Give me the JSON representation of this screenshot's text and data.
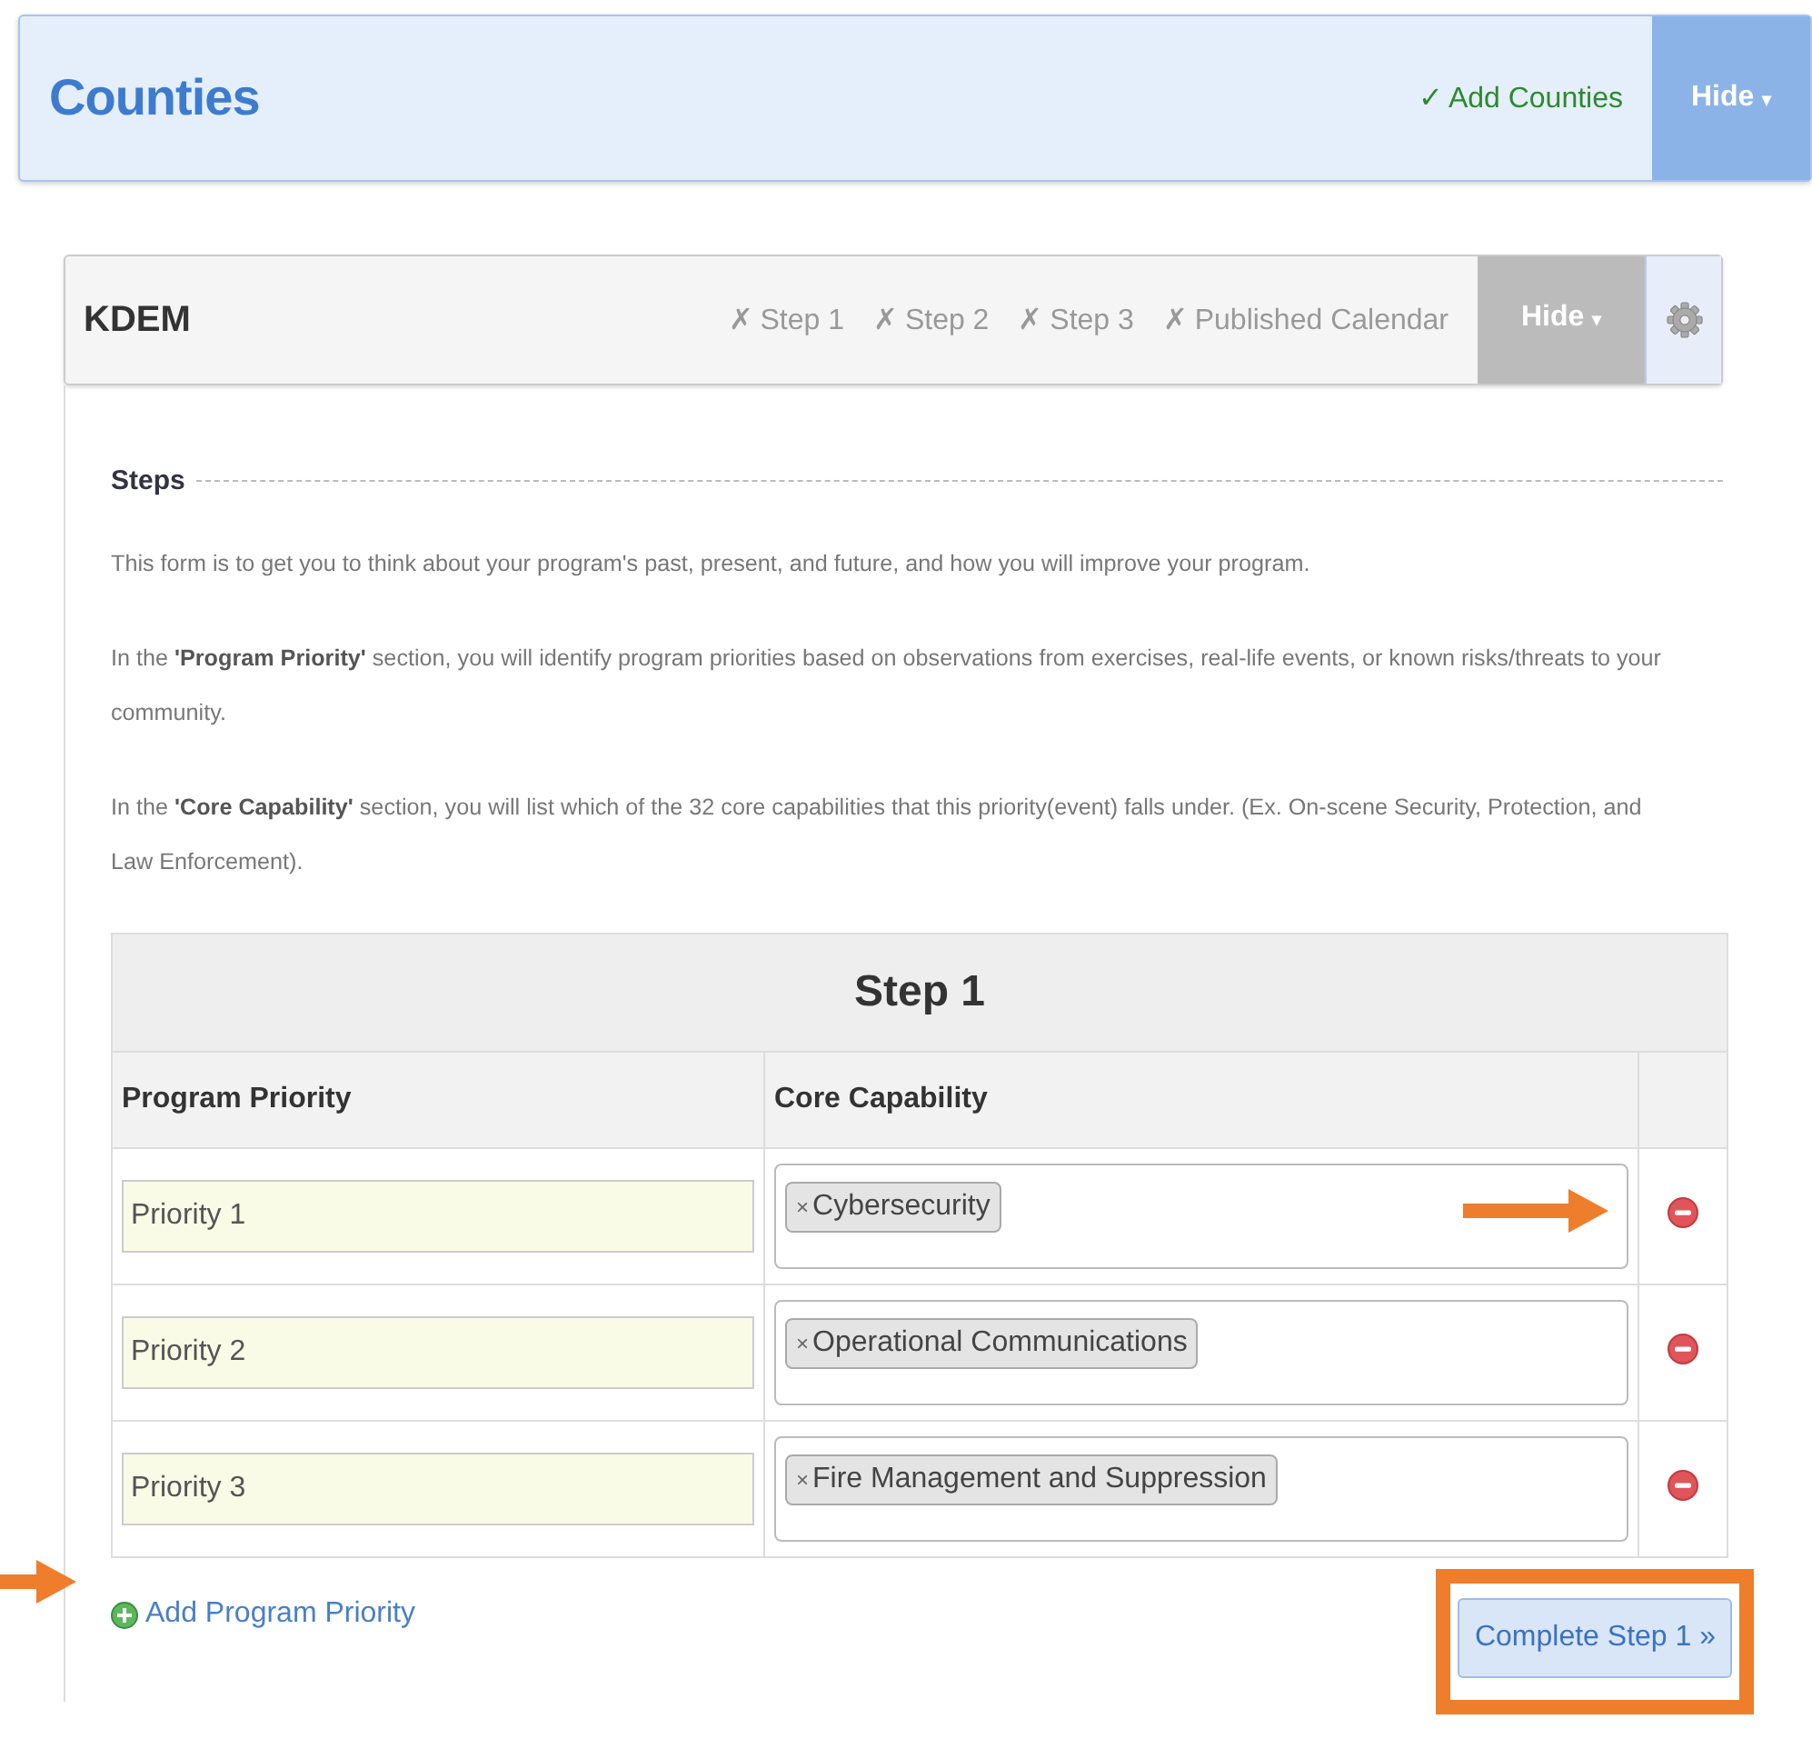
{
  "counties": {
    "title": "Counties",
    "status": {
      "mark": "✓",
      "label": "Add Counties",
      "done": true
    },
    "hide_button": "Hide",
    "hide_caret": "▾"
  },
  "agency": {
    "title": "KDEM",
    "steps": [
      {
        "mark": "✗",
        "label": "Step 1",
        "done": false
      },
      {
        "mark": "✗",
        "label": "Step 2",
        "done": false
      },
      {
        "mark": "✗",
        "label": "Step 3",
        "done": false
      },
      {
        "mark": "✗",
        "label": "Published Calendar",
        "done": false
      }
    ],
    "hide_button": "Hide",
    "hide_caret": "▾"
  },
  "section": {
    "legend": "Steps",
    "paragraphs": [
      "This form is to get you to think about your program's past, present, and future, and how you will improve your program.",
      "In the **'Program Priority'** section, you will identify program priorities based on observations from exercises, real-life events, or known risks/threats to your community.",
      "In the **'Core Capability'** section, you will list which of the 32 core capabilities that this priority(event) falls under. (Ex. On-scene Security, Protection, and Law Enforcement)."
    ]
  },
  "table": {
    "title": "Step 1",
    "columns": [
      "Program Priority",
      "Core Capability"
    ],
    "rows": [
      {
        "priority": "Priority 1",
        "capabilities": [
          {
            "remove": "×",
            "label": "Cybersecurity"
          }
        ],
        "annotated": true
      },
      {
        "priority": "Priority 2",
        "capabilities": [
          {
            "remove": "×",
            "label": "Operational Communications"
          }
        ],
        "annotated": false
      },
      {
        "priority": "Priority 3",
        "capabilities": [
          {
            "remove": "×",
            "label": "Fire Management and Suppression"
          }
        ],
        "annotated": false
      }
    ]
  },
  "add_link": {
    "label": "Add Program Priority",
    "annotated": true
  },
  "complete_button": {
    "label": "Complete Step 1 »",
    "highlighted": true
  }
}
